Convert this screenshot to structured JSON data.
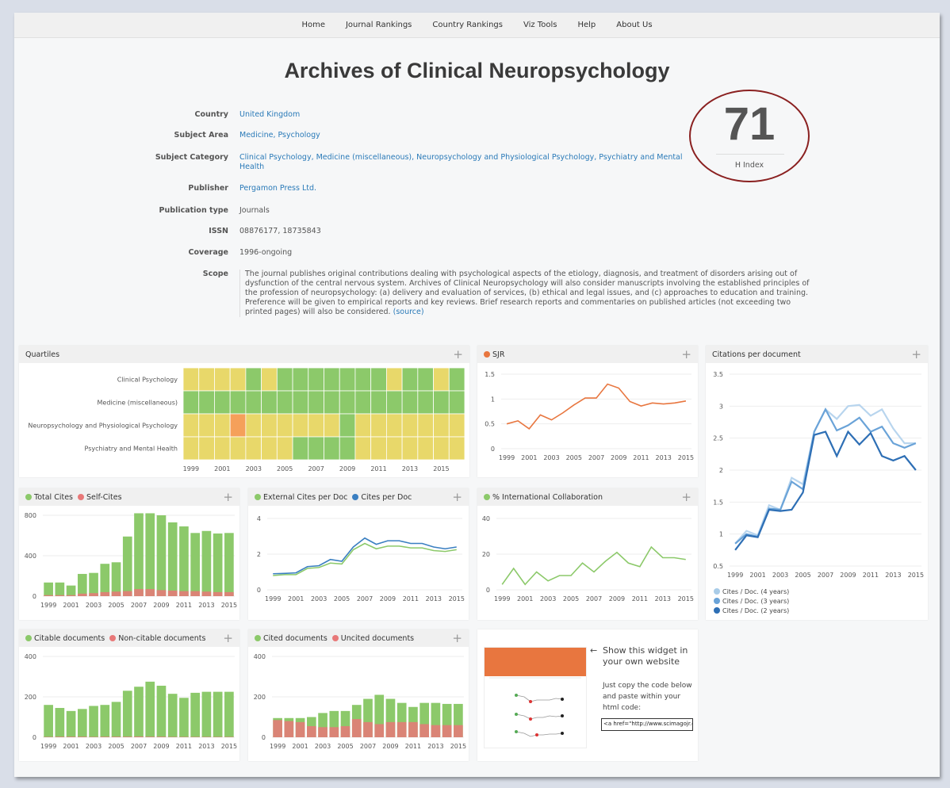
{
  "nav": [
    "Home",
    "Journal Rankings",
    "Country Rankings",
    "Viz Tools",
    "Help",
    "About Us"
  ],
  "title": "Archives of Clinical Neuropsychology",
  "info": {
    "country": {
      "label": "Country",
      "value": "United Kingdom"
    },
    "subject_area": {
      "label": "Subject Area",
      "value": "Medicine, Psychology"
    },
    "subject_category": {
      "label": "Subject Category",
      "value": "Clinical Psychology, Medicine (miscellaneous), Neuropsychology and Physiological Psychology, Psychiatry and Mental Health"
    },
    "publisher": {
      "label": "Publisher",
      "value": "Pergamon Press Ltd."
    },
    "publication_type": {
      "label": "Publication type",
      "value": "Journals"
    },
    "issn": {
      "label": "ISSN",
      "value": "08876177, 18735843"
    },
    "coverage": {
      "label": "Coverage",
      "value": "1996-ongoing"
    },
    "scope": {
      "label": "Scope",
      "value": "The journal publishes original contributions dealing with psychological aspects of the etiology, diagnosis, and treatment of disorders arising out of dysfunction of the central nervous system. Archives of Clinical Neuropsychology will also consider manuscripts involving the established principles of the profession of neuropsychology: (a) delivery and evaluation of services, (b) ethical and legal issues, and (c) approaches to education and training. Preference will be given to empirical reports and key reviews. Brief research reports and commentaries on published articles (not exceeding two printed pages) will also be considered.",
      "source": "(source)"
    }
  },
  "hindex": {
    "value": "71",
    "label": "H Index"
  },
  "colors": {
    "green": "#8cc96a",
    "red": "#e87878",
    "orange": "#e8763f",
    "blue": "#3a7fc1",
    "lightblue": "#a9cce8",
    "midblue": "#6aa3d8",
    "q1": "#8cc96a",
    "q2": "#e8d86a",
    "q3": "#f5a05a"
  },
  "panels": {
    "quartiles": {
      "title": "Quartiles"
    },
    "sjr": {
      "title": "SJR"
    },
    "cpd": {
      "title": "Citations per document",
      "legend": [
        "Cites / Doc. (4 years)",
        "Cites / Doc. (3 years)",
        "Cites / Doc. (2 years)"
      ]
    },
    "cites": {
      "legend": [
        "Total Cites",
        "Self-Cites"
      ]
    },
    "ext": {
      "legend": [
        "External Cites per Doc",
        "Cites per Doc"
      ]
    },
    "intl": {
      "legend": [
        "% International Collaboration"
      ]
    },
    "citable": {
      "legend": [
        "Citable documents",
        "Non-citable documents"
      ]
    },
    "cited": {
      "legend": [
        "Cited documents",
        "Uncited documents"
      ]
    },
    "widget": {
      "title": "Show this widget in your own website",
      "text": "Just copy the code below and paste within your html code:",
      "code": "<a href=\"http://www.scimagojr.com"
    }
  },
  "chart_data": [
    {
      "id": "quartiles",
      "type": "heatmap",
      "rows": [
        "Clinical Psychology",
        "Medicine (miscellaneous)",
        "Neuropsychology and Physiological Psychology",
        "Psychiatry and Mental Health"
      ],
      "x": [
        1999,
        2000,
        2001,
        2002,
        2003,
        2004,
        2005,
        2006,
        2007,
        2008,
        2009,
        2010,
        2011,
        2012,
        2013,
        2014,
        2015,
        2016
      ],
      "values": [
        [
          "Q2",
          "Q2",
          "Q2",
          "Q2",
          "Q1",
          "Q2",
          "Q1",
          "Q1",
          "Q1",
          "Q1",
          "Q1",
          "Q1",
          "Q1",
          "Q2",
          "Q1",
          "Q1",
          "Q2",
          "Q1"
        ],
        [
          "Q1",
          "Q1",
          "Q1",
          "Q1",
          "Q1",
          "Q1",
          "Q1",
          "Q1",
          "Q1",
          "Q1",
          "Q1",
          "Q1",
          "Q1",
          "Q1",
          "Q1",
          "Q1",
          "Q1",
          "Q1"
        ],
        [
          "Q2",
          "Q2",
          "Q2",
          "Q3",
          "Q2",
          "Q2",
          "Q2",
          "Q2",
          "Q2",
          "Q2",
          "Q1",
          "Q2",
          "Q2",
          "Q2",
          "Q2",
          "Q2",
          "Q2",
          "Q2"
        ],
        [
          "Q2",
          "Q2",
          "Q2",
          "Q2",
          "Q2",
          "Q2",
          "Q2",
          "Q1",
          "Q1",
          "Q1",
          "Q1",
          "Q2",
          "Q2",
          "Q2",
          "Q2",
          "Q2",
          "Q2",
          "Q2"
        ]
      ],
      "xticks": [
        1999,
        2001,
        2003,
        2005,
        2007,
        2009,
        2011,
        2013,
        2015
      ]
    },
    {
      "id": "sjr",
      "type": "line",
      "x": [
        1999,
        2000,
        2001,
        2002,
        2003,
        2004,
        2005,
        2006,
        2007,
        2008,
        2009,
        2010,
        2011,
        2012,
        2013,
        2014,
        2015
      ],
      "series": [
        {
          "name": "SJR",
          "values": [
            0.5,
            0.56,
            0.4,
            0.68,
            0.58,
            0.72,
            0.88,
            1.02,
            1.02,
            1.3,
            1.22,
            0.95,
            0.86,
            0.92,
            0.9,
            0.92,
            0.96
          ]
        }
      ],
      "ylim": [
        0,
        1.5
      ],
      "yticks": [
        0,
        0.5,
        1,
        1.5
      ]
    },
    {
      "id": "cpd",
      "type": "line",
      "x": [
        1999,
        2000,
        2001,
        2002,
        2003,
        2004,
        2005,
        2006,
        2007,
        2008,
        2009,
        2010,
        2011,
        2012,
        2013,
        2014,
        2015
      ],
      "series": [
        {
          "name": "Cites / Doc. (4 years)",
          "values": [
            0.85,
            1.05,
            0.98,
            1.45,
            1.38,
            1.88,
            1.78,
            2.6,
            2.95,
            2.8,
            3.0,
            3.02,
            2.85,
            2.95,
            2.65,
            2.42,
            2.42
          ]
        },
        {
          "name": "Cites / Doc. (3 years)",
          "values": [
            0.85,
            1.0,
            0.96,
            1.4,
            1.38,
            1.82,
            1.7,
            2.6,
            2.95,
            2.62,
            2.7,
            2.82,
            2.6,
            2.68,
            2.42,
            2.35,
            2.42
          ]
        },
        {
          "name": "Cites / Doc. (2 years)",
          "values": [
            0.75,
            0.98,
            0.95,
            1.38,
            1.36,
            1.38,
            1.65,
            2.55,
            2.6,
            2.22,
            2.6,
            2.4,
            2.58,
            2.22,
            2.15,
            2.22,
            2.0
          ]
        }
      ],
      "ylim": [
        0.5,
        3.5
      ],
      "yticks": [
        0.5,
        1,
        1.5,
        2,
        2.5,
        3,
        3.5
      ]
    },
    {
      "id": "cites",
      "type": "bar",
      "x": [
        1999,
        2000,
        2001,
        2002,
        2003,
        2004,
        2005,
        2006,
        2007,
        2008,
        2009,
        2010,
        2011,
        2012,
        2013,
        2014,
        2015
      ],
      "series": [
        {
          "name": "Total Cites",
          "values": [
            135,
            135,
            105,
            220,
            230,
            320,
            335,
            590,
            820,
            820,
            800,
            730,
            690,
            625,
            645,
            620,
            625
          ]
        },
        {
          "name": "Self-Cites",
          "values": [
            10,
            10,
            10,
            25,
            30,
            40,
            45,
            50,
            70,
            70,
            60,
            55,
            50,
            50,
            45,
            40,
            40
          ]
        }
      ],
      "ylim": [
        0,
        800
      ],
      "yticks": [
        0,
        400,
        800
      ]
    },
    {
      "id": "ext",
      "type": "line",
      "x": [
        1999,
        2000,
        2001,
        2002,
        2003,
        2004,
        2005,
        2006,
        2007,
        2008,
        2009,
        2010,
        2011,
        2012,
        2013,
        2014,
        2015
      ],
      "series": [
        {
          "name": "External Cites per Doc",
          "values": [
            0.8,
            0.85,
            0.85,
            1.2,
            1.25,
            1.5,
            1.45,
            2.25,
            2.6,
            2.3,
            2.45,
            2.45,
            2.35,
            2.35,
            2.2,
            2.15,
            2.25
          ]
        },
        {
          "name": "Cites per Doc",
          "values": [
            0.9,
            0.92,
            0.95,
            1.3,
            1.35,
            1.7,
            1.6,
            2.4,
            2.9,
            2.55,
            2.75,
            2.75,
            2.6,
            2.6,
            2.4,
            2.3,
            2.4
          ]
        }
      ],
      "ylim": [
        0,
        4
      ],
      "yticks": [
        0,
        2,
        4
      ]
    },
    {
      "id": "intl",
      "type": "line",
      "x": [
        1999,
        2000,
        2001,
        2002,
        2003,
        2004,
        2005,
        2006,
        2007,
        2008,
        2009,
        2010,
        2011,
        2012,
        2013,
        2014,
        2015
      ],
      "series": [
        {
          "name": "% International Collaboration",
          "values": [
            3,
            12,
            3,
            10,
            5,
            8,
            8,
            15,
            10,
            16,
            21,
            15,
            13,
            24,
            18,
            18,
            17
          ]
        }
      ],
      "ylim": [
        0,
        40
      ],
      "yticks": [
        0,
        20,
        40
      ]
    },
    {
      "id": "citable",
      "type": "bar",
      "x": [
        1999,
        2000,
        2001,
        2002,
        2003,
        2004,
        2005,
        2006,
        2007,
        2008,
        2009,
        2010,
        2011,
        2012,
        2013,
        2014,
        2015
      ],
      "series": [
        {
          "name": "Citable documents",
          "values": [
            160,
            145,
            130,
            140,
            155,
            160,
            175,
            230,
            250,
            275,
            255,
            215,
            195,
            220,
            225,
            225,
            225
          ]
        },
        {
          "name": "Non-citable documents",
          "values": [
            2,
            3,
            3,
            3,
            2,
            3,
            3,
            3,
            4,
            3,
            3,
            2,
            2,
            2,
            2,
            2,
            2
          ]
        }
      ],
      "ylim": [
        0,
        400
      ],
      "yticks": [
        0,
        200,
        400
      ]
    },
    {
      "id": "cited",
      "type": "bar",
      "x": [
        1999,
        2000,
        2001,
        2002,
        2003,
        2004,
        2005,
        2006,
        2007,
        2008,
        2009,
        2010,
        2011,
        2012,
        2013,
        2014,
        2015
      ],
      "series": [
        {
          "name": "Cited documents",
          "values": [
            95,
            95,
            95,
            100,
            120,
            130,
            130,
            160,
            190,
            210,
            190,
            170,
            150,
            170,
            170,
            165,
            165
          ]
        },
        {
          "name": "Uncited documents",
          "values": [
            85,
            80,
            75,
            55,
            50,
            50,
            55,
            90,
            75,
            65,
            75,
            75,
            75,
            65,
            60,
            60,
            60
          ]
        }
      ],
      "ylim": [
        0,
        400
      ],
      "yticks": [
        0,
        200,
        400
      ]
    }
  ],
  "year_ticks": [
    "1999",
    "2001",
    "2003",
    "2005",
    "2007",
    "2009",
    "2011",
    "2013",
    "2015"
  ]
}
